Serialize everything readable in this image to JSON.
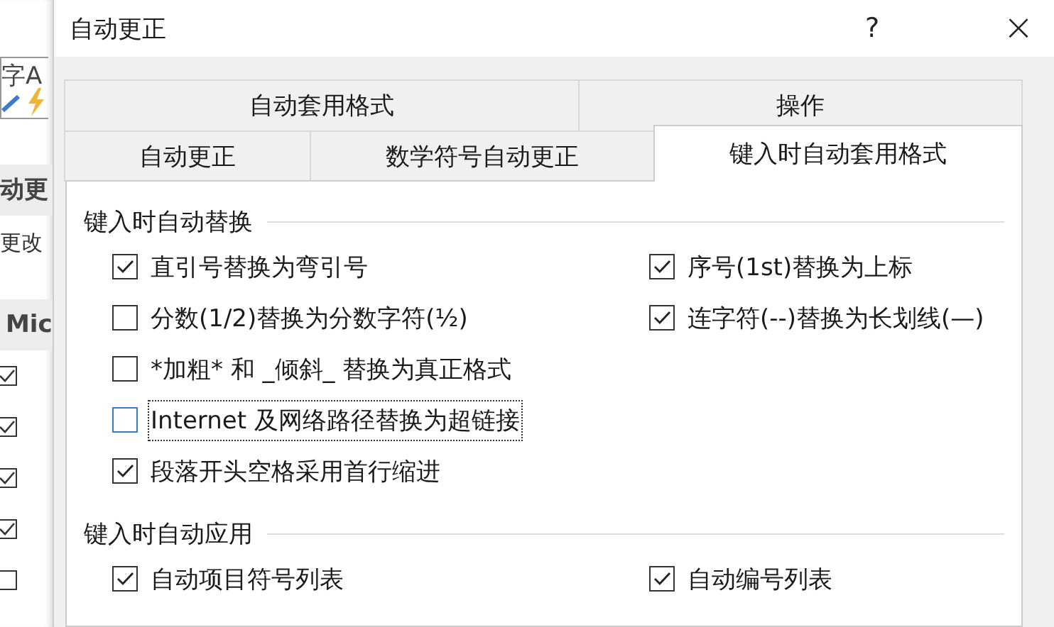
{
  "background_window": {
    "icon_text": "字A",
    "heading_1": "动更",
    "text": "更改",
    "heading_2": "Mic",
    "items": [
      {
        "checked": true
      },
      {
        "checked": true
      },
      {
        "checked": true
      },
      {
        "checked": true
      },
      {
        "checked": false
      }
    ]
  },
  "window": {
    "title": "自动更正",
    "help": "?",
    "close": "×"
  },
  "tabs_row_1": [
    {
      "label": "自动套用格式",
      "selected": false
    },
    {
      "label": "操作",
      "selected": false
    }
  ],
  "tabs_row_2": [
    {
      "label": "自动更正",
      "selected": false
    },
    {
      "label": "数学符号自动更正",
      "selected": false
    },
    {
      "label": "键入时自动套用格式",
      "selected": true
    }
  ],
  "groups": [
    {
      "title": "键入时自动替换",
      "rows": [
        [
          {
            "label": "直引号替换为弯引号",
            "checked": true,
            "focused": false
          },
          {
            "label": "序号(1st)替换为上标",
            "checked": true,
            "focused": false
          }
        ],
        [
          {
            "label": "分数(1/2)替换为分数字符(½)",
            "checked": false,
            "focused": false
          },
          {
            "label": "连字符(--)替换为长划线(—)",
            "checked": true,
            "focused": false
          }
        ],
        [
          {
            "label": "*加粗* 和 _倾斜_ 替换为真正格式",
            "checked": false,
            "focused": false
          }
        ],
        [
          {
            "label": "Internet 及网络路径替换为超链接",
            "checked": false,
            "focused": true
          }
        ],
        [
          {
            "label": "段落开头空格采用首行缩进",
            "checked": true,
            "focused": false
          }
        ]
      ]
    },
    {
      "title": "键入时自动应用",
      "rows": [
        [
          {
            "label": "自动项目符号列表",
            "checked": true,
            "focused": false
          },
          {
            "label": "自动编号列表",
            "checked": true,
            "focused": false
          }
        ]
      ]
    }
  ]
}
